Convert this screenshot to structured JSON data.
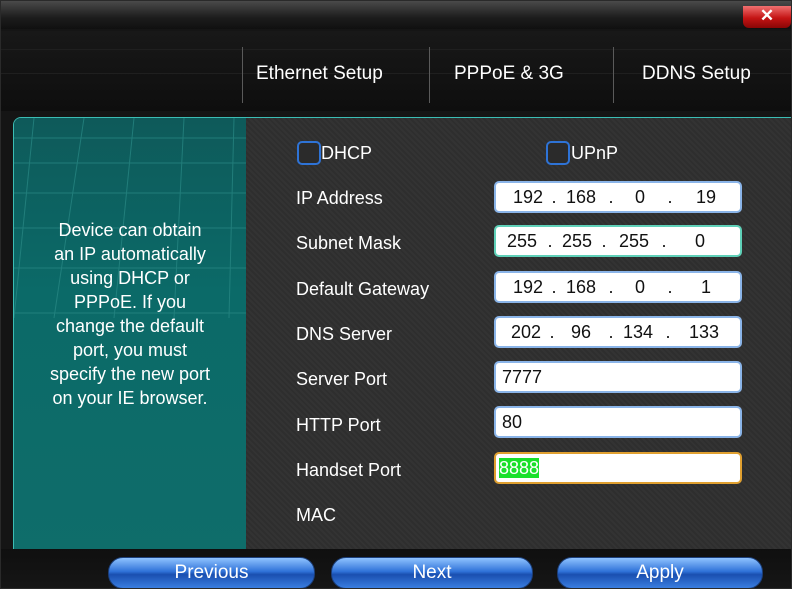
{
  "window": {
    "close_label": "✕"
  },
  "tabs": [
    "Ethernet Setup",
    "PPPoE & 3G",
    "DDNS Setup"
  ],
  "info": {
    "lines": [
      "Device can obtain",
      "an IP automatically",
      "using DHCP or",
      "PPPoE. If you",
      "change the default",
      "port, you must",
      "specify the new port",
      "on your IE browser."
    ]
  },
  "checks": {
    "dhcp": "DHCP",
    "upnp": "UPnP"
  },
  "fields": {
    "ip": {
      "label": "IP Address",
      "octets": [
        "192",
        "168",
        "0",
        "19"
      ]
    },
    "mask": {
      "label": "Subnet Mask",
      "octets": [
        "255",
        "255",
        "255",
        "0"
      ]
    },
    "gateway": {
      "label": "Default Gateway",
      "octets": [
        "192",
        "168",
        "0",
        "1"
      ]
    },
    "dns": {
      "label": "DNS Server",
      "octets": [
        "202",
        "96",
        "134",
        "133"
      ]
    },
    "server_port": {
      "label": "Server Port",
      "value": "7777"
    },
    "http_port": {
      "label": "HTTP Port",
      "value": "80"
    },
    "handset_port": {
      "label": "Handset Port",
      "value": "8888"
    },
    "mac": {
      "label": "MAC"
    }
  },
  "buttons": {
    "previous": "Previous",
    "next": "Next",
    "apply": "Apply"
  },
  "colors": {
    "accent": "#3bbdb4",
    "button": "#2f72d8",
    "selection": "#19e02a",
    "close": "#c41414"
  }
}
